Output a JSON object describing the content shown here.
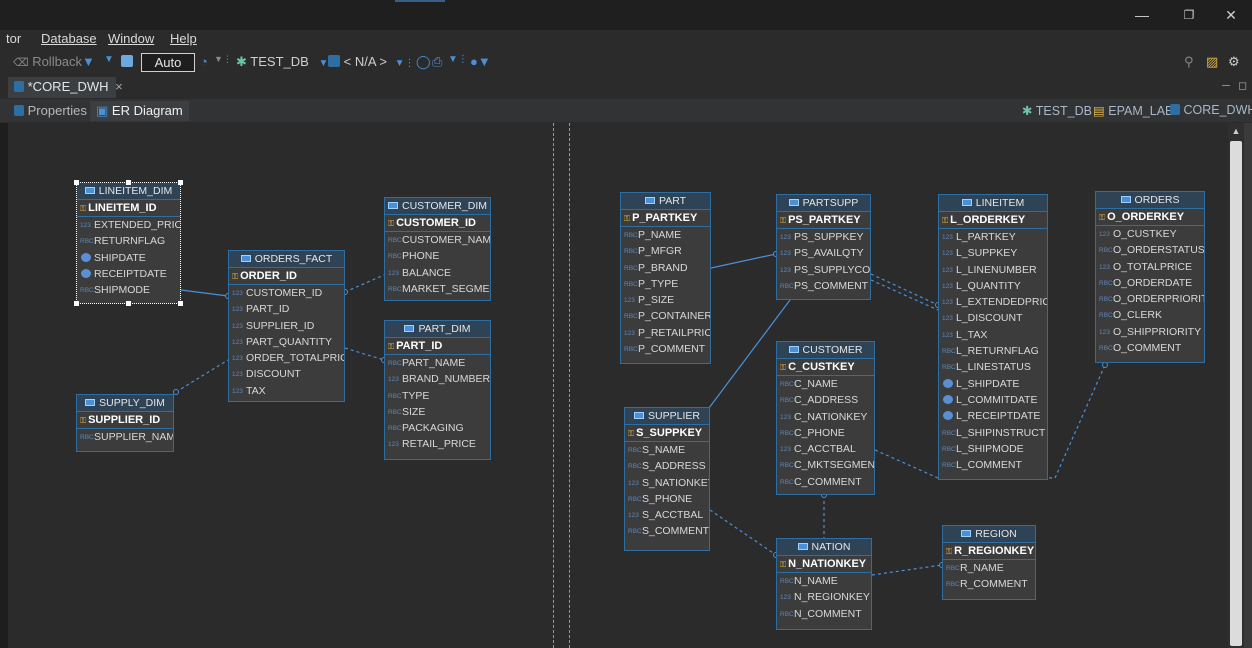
{
  "menu": [
    {
      "label": "tor",
      "underline": false
    },
    {
      "label": "Database",
      "underline": true
    },
    {
      "label": "Window",
      "underline": true
    },
    {
      "label": "Help",
      "underline": true
    }
  ],
  "toolbar": {
    "rollback": "Rollback",
    "auto": "Auto",
    "datasource": "TEST_DB",
    "schema": "< N/A >"
  },
  "doc_tab": {
    "label": "*CORE_DWH",
    "close": "×"
  },
  "editor_tabs": {
    "properties": "Properties",
    "er_diagram": "ER Diagram"
  },
  "breadcrumbs": [
    "TEST_DB",
    "EPAM_LAB",
    "CORE_DWH"
  ],
  "colors": {
    "entity_border": "#2d6ea3",
    "entity_bg": "#3c3c3c",
    "relation": "#4a90d9"
  },
  "entities": [
    {
      "name": "LINEITEM_DIM",
      "pk": "LINEITEM_ID",
      "cols": [
        {
          "type": "123",
          "name": "EXTENDED_PRICE"
        },
        {
          "type": "RBC",
          "name": "RETURNFLAG"
        },
        {
          "type": "date",
          "name": "SHIPDATE"
        },
        {
          "type": "date",
          "name": "RECEIPTDATE"
        },
        {
          "type": "RBC",
          "name": "SHIPMODE"
        }
      ]
    },
    {
      "name": "ORDERS_FACT",
      "pk": "ORDER_ID",
      "cols": [
        {
          "type": "123",
          "name": "CUSTOMER_ID"
        },
        {
          "type": "123",
          "name": "PART_ID"
        },
        {
          "type": "123",
          "name": "SUPPLIER_ID"
        },
        {
          "type": "123",
          "name": "PART_QUANTITY"
        },
        {
          "type": "123",
          "name": "ORDER_TOTALPRICE"
        },
        {
          "type": "123",
          "name": "DISCOUNT"
        },
        {
          "type": "123",
          "name": "TAX"
        }
      ]
    },
    {
      "name": "CUSTOMER_DIM",
      "pk": "CUSTOMER_ID",
      "cols": [
        {
          "type": "RBC",
          "name": "CUSTOMER_NAME"
        },
        {
          "type": "RBC",
          "name": "PHONE"
        },
        {
          "type": "123",
          "name": "BALANCE"
        },
        {
          "type": "RBC",
          "name": "MARKET_SEGMENT"
        }
      ]
    },
    {
      "name": "PART_DIM",
      "pk": "PART_ID",
      "cols": [
        {
          "type": "RBC",
          "name": "PART_NAME"
        },
        {
          "type": "123",
          "name": "BRAND_NUMBER"
        },
        {
          "type": "RBC",
          "name": "TYPE"
        },
        {
          "type": "RBC",
          "name": "SIZE"
        },
        {
          "type": "RBC",
          "name": "PACKAGING"
        },
        {
          "type": "123",
          "name": "RETAIL_PRICE"
        }
      ]
    },
    {
      "name": "SUPPLY_DIM",
      "pk": "SUPPLIER_ID",
      "cols": [
        {
          "type": "RBC",
          "name": "SUPPLIER_NAME"
        }
      ]
    },
    {
      "name": "PART",
      "pk": "P_PARTKEY",
      "cols": [
        {
          "type": "RBC",
          "name": "P_NAME"
        },
        {
          "type": "RBC",
          "name": "P_MFGR"
        },
        {
          "type": "RBC",
          "name": "P_BRAND"
        },
        {
          "type": "RBC",
          "name": "P_TYPE"
        },
        {
          "type": "123",
          "name": "P_SIZE"
        },
        {
          "type": "RBC",
          "name": "P_CONTAINER"
        },
        {
          "type": "123",
          "name": "P_RETAILPRICE"
        },
        {
          "type": "RBC",
          "name": "P_COMMENT"
        }
      ]
    },
    {
      "name": "PARTSUPP",
      "pk": "PS_PARTKEY",
      "cols": [
        {
          "type": "123",
          "name": "PS_SUPPKEY"
        },
        {
          "type": "123",
          "name": "PS_AVAILQTY"
        },
        {
          "type": "123",
          "name": "PS_SUPPLYCOST"
        },
        {
          "type": "RBC",
          "name": "PS_COMMENT"
        }
      ]
    },
    {
      "name": "LINEITEM",
      "pk": "L_ORDERKEY",
      "cols": [
        {
          "type": "123",
          "name": "L_PARTKEY"
        },
        {
          "type": "123",
          "name": "L_SUPPKEY"
        },
        {
          "type": "123",
          "name": "L_LINENUMBER"
        },
        {
          "type": "123",
          "name": "L_QUANTITY"
        },
        {
          "type": "123",
          "name": "L_EXTENDEDPRICE"
        },
        {
          "type": "123",
          "name": "L_DISCOUNT"
        },
        {
          "type": "123",
          "name": "L_TAX"
        },
        {
          "type": "RBC",
          "name": "L_RETURNFLAG"
        },
        {
          "type": "RBC",
          "name": "L_LINESTATUS"
        },
        {
          "type": "date",
          "name": "L_SHIPDATE"
        },
        {
          "type": "date",
          "name": "L_COMMITDATE"
        },
        {
          "type": "date",
          "name": "L_RECEIPTDATE"
        },
        {
          "type": "RBC",
          "name": "L_SHIPINSTRUCT"
        },
        {
          "type": "RBC",
          "name": "L_SHIPMODE"
        },
        {
          "type": "RBC",
          "name": "L_COMMENT"
        }
      ]
    },
    {
      "name": "ORDERS",
      "pk": "O_ORDERKEY",
      "cols": [
        {
          "type": "123",
          "name": "O_CUSTKEY"
        },
        {
          "type": "RBC",
          "name": "O_ORDERSTATUS"
        },
        {
          "type": "123",
          "name": "O_TOTALPRICE"
        },
        {
          "type": "RBC",
          "name": "O_ORDERDATE"
        },
        {
          "type": "RBC",
          "name": "O_ORDERPRIORITY"
        },
        {
          "type": "RBC",
          "name": "O_CLERK"
        },
        {
          "type": "123",
          "name": "O_SHIPPRIORITY"
        },
        {
          "type": "RBC",
          "name": "O_COMMENT"
        }
      ]
    },
    {
      "name": "CUSTOMER",
      "pk": "C_CUSTKEY",
      "cols": [
        {
          "type": "RBC",
          "name": "C_NAME"
        },
        {
          "type": "RBC",
          "name": "C_ADDRESS"
        },
        {
          "type": "123",
          "name": "C_NATIONKEY"
        },
        {
          "type": "RBC",
          "name": "C_PHONE"
        },
        {
          "type": "123",
          "name": "C_ACCTBAL"
        },
        {
          "type": "RBC",
          "name": "C_MKTSEGMENT"
        },
        {
          "type": "RBC",
          "name": "C_COMMENT"
        }
      ]
    },
    {
      "name": "SUPPLIER",
      "pk": "S_SUPPKEY",
      "cols": [
        {
          "type": "RBC",
          "name": "S_NAME"
        },
        {
          "type": "RBC",
          "name": "S_ADDRESS"
        },
        {
          "type": "123",
          "name": "S_NATIONKEY"
        },
        {
          "type": "RBC",
          "name": "S_PHONE"
        },
        {
          "type": "123",
          "name": "S_ACCTBAL"
        },
        {
          "type": "RBC",
          "name": "S_COMMENT"
        }
      ]
    },
    {
      "name": "NATION",
      "pk": "N_NATIONKEY",
      "cols": [
        {
          "type": "RBC",
          "name": "N_NAME"
        },
        {
          "type": "123",
          "name": "N_REGIONKEY"
        },
        {
          "type": "RBC",
          "name": "N_COMMENT"
        }
      ]
    },
    {
      "name": "REGION",
      "pk": "R_REGIONKEY",
      "cols": [
        {
          "type": "RBC",
          "name": "R_NAME"
        },
        {
          "type": "RBC",
          "name": "R_COMMENT"
        }
      ]
    }
  ]
}
